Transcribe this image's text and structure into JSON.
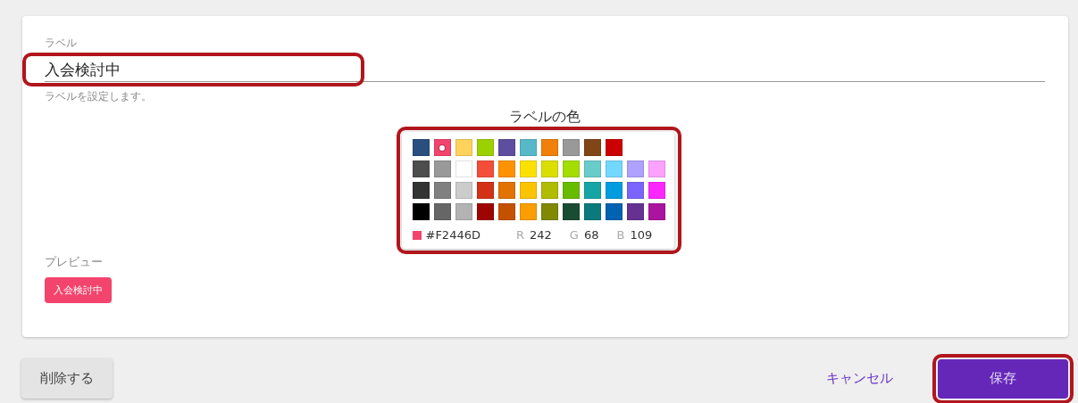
{
  "label_field": {
    "label": "ラベル",
    "value": "入会検討中",
    "helper": "ラベルを設定します。",
    "highlighted": true
  },
  "color_picker": {
    "title": "ラベルの色",
    "highlighted": true,
    "rows": [
      [
        {
          "color": "#2a4f7f",
          "selected": false
        },
        {
          "color": "#f2446d",
          "selected": true
        },
        {
          "color": "#fdd35c",
          "selected": false
        },
        {
          "color": "#9cd100",
          "selected": false
        },
        {
          "color": "#5d4ea0",
          "selected": false
        },
        {
          "color": "#57b9c8",
          "selected": false
        },
        {
          "color": "#f0800a",
          "selected": false
        },
        {
          "color": "#999999",
          "selected": false
        },
        {
          "color": "#824515",
          "selected": false
        },
        {
          "color": "#cc0000",
          "selected": false
        }
      ],
      [
        {
          "color": "#4d4d4d",
          "selected": false
        },
        {
          "color": "#999999",
          "selected": false
        },
        {
          "color": "#ffffff",
          "selected": false
        },
        {
          "color": "#f44e3b",
          "selected": false
        },
        {
          "color": "#fe9200",
          "selected": false
        },
        {
          "color": "#fce100",
          "selected": false
        },
        {
          "color": "#dbdf00",
          "selected": false
        },
        {
          "color": "#a4dd00",
          "selected": false
        },
        {
          "color": "#68ccca",
          "selected": false
        },
        {
          "color": "#73d8ff",
          "selected": false
        },
        {
          "color": "#aea1ff",
          "selected": false
        },
        {
          "color": "#fda1ff",
          "selected": false
        }
      ],
      [
        {
          "color": "#333333",
          "selected": false
        },
        {
          "color": "#808080",
          "selected": false
        },
        {
          "color": "#cccccc",
          "selected": false
        },
        {
          "color": "#d33115",
          "selected": false
        },
        {
          "color": "#e27300",
          "selected": false
        },
        {
          "color": "#fcc400",
          "selected": false
        },
        {
          "color": "#b0bc00",
          "selected": false
        },
        {
          "color": "#68bc00",
          "selected": false
        },
        {
          "color": "#16a5a5",
          "selected": false
        },
        {
          "color": "#009ce0",
          "selected": false
        },
        {
          "color": "#7b64ff",
          "selected": false
        },
        {
          "color": "#fa28ff",
          "selected": false
        }
      ],
      [
        {
          "color": "#000000",
          "selected": false
        },
        {
          "color": "#666666",
          "selected": false
        },
        {
          "color": "#b3b3b3",
          "selected": false
        },
        {
          "color": "#9f0500",
          "selected": false
        },
        {
          "color": "#c45100",
          "selected": false
        },
        {
          "color": "#fb9e00",
          "selected": false
        },
        {
          "color": "#808900",
          "selected": false
        },
        {
          "color": "#194d33",
          "selected": false
        },
        {
          "color": "#0c797d",
          "selected": false
        },
        {
          "color": "#0062b1",
          "selected": false
        },
        {
          "color": "#653294",
          "selected": false
        },
        {
          "color": "#ab149e",
          "selected": false
        }
      ]
    ],
    "current": {
      "color": "#f2446d",
      "hex": "#F2446D",
      "r_label": "R",
      "r": "242",
      "g_label": "G",
      "g": "68",
      "b_label": "B",
      "b": "109"
    }
  },
  "preview": {
    "label": "プレビュー",
    "chip": {
      "text": "入会検討中",
      "color": "#f2446d"
    }
  },
  "buttons": {
    "delete": "削除する",
    "cancel": "キャンセル",
    "save": {
      "text": "保存",
      "highlighted": true
    }
  }
}
